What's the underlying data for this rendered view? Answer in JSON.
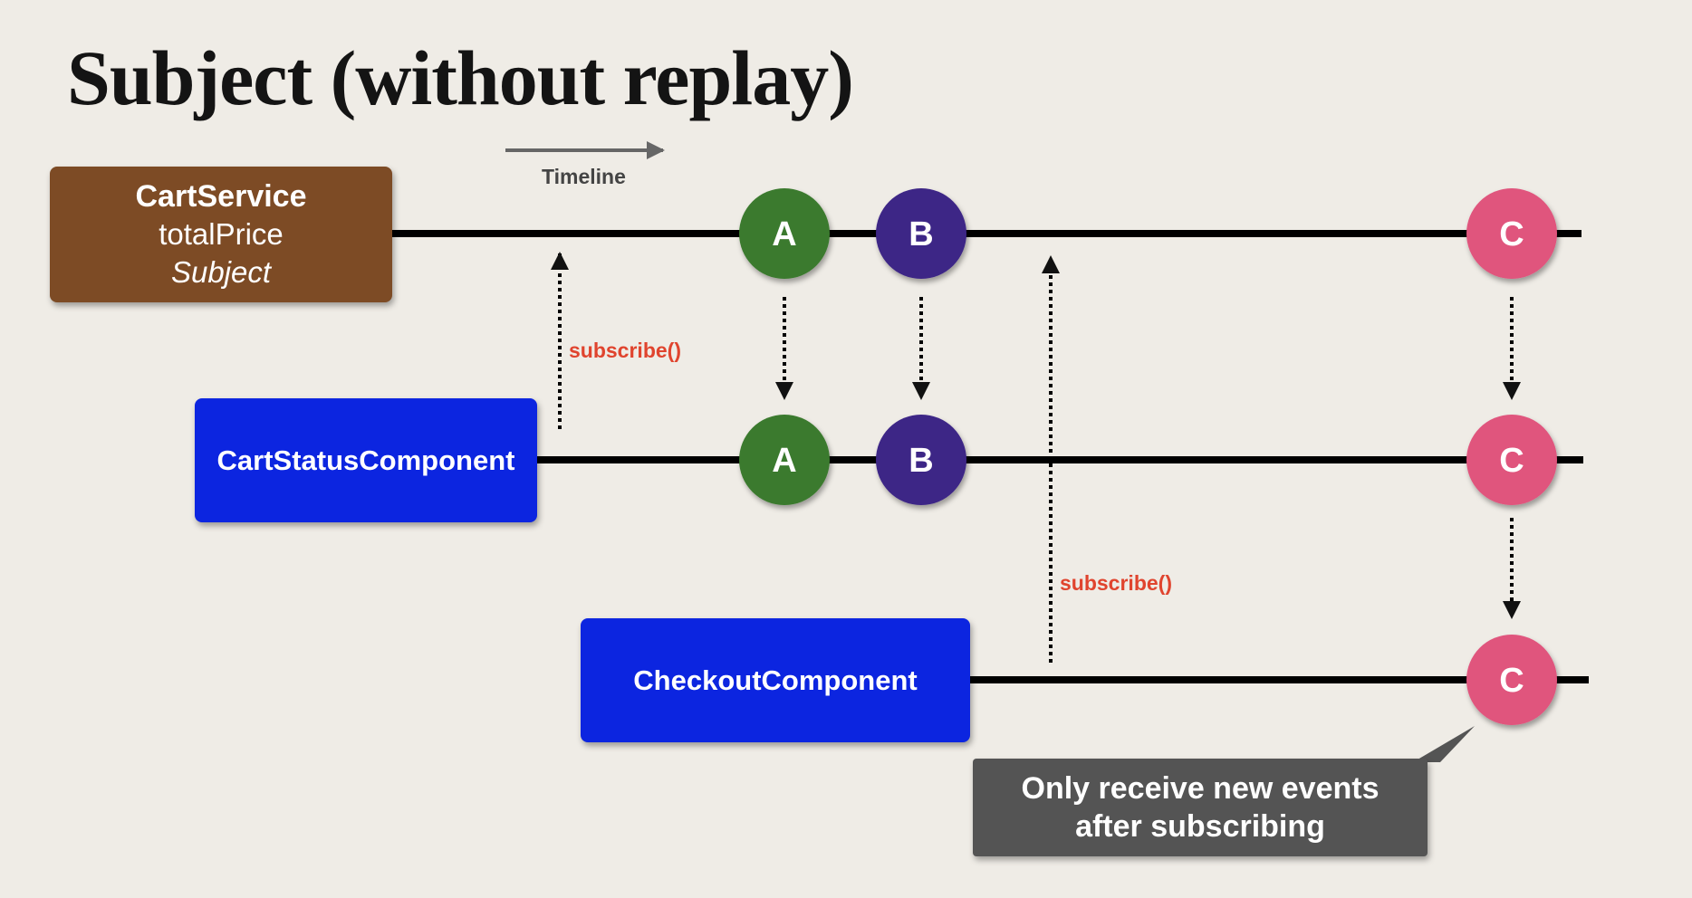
{
  "title": "Subject (without replay)",
  "timeline_label": "Timeline",
  "service_box": {
    "name": "CartService",
    "property": "totalPrice",
    "type": "Subject"
  },
  "status_component": {
    "name": "CartStatusComponent"
  },
  "checkout_component": {
    "name": "CheckoutComponent"
  },
  "subscribe_label_1": "subscribe()",
  "subscribe_label_2": "subscribe()",
  "events": {
    "a": {
      "label": "A",
      "color": "#3b7a2e"
    },
    "b": {
      "label": "B",
      "color": "#3d2586"
    },
    "c": {
      "label": "C",
      "color": "#e0547d"
    }
  },
  "callout": {
    "line1": "Only receive new events",
    "line2": "after subscribing"
  },
  "colors": {
    "brown": "#7d4b25",
    "blue": "#0c25e0",
    "accent_red": "#e0442e",
    "callout_gray": "#545454"
  }
}
